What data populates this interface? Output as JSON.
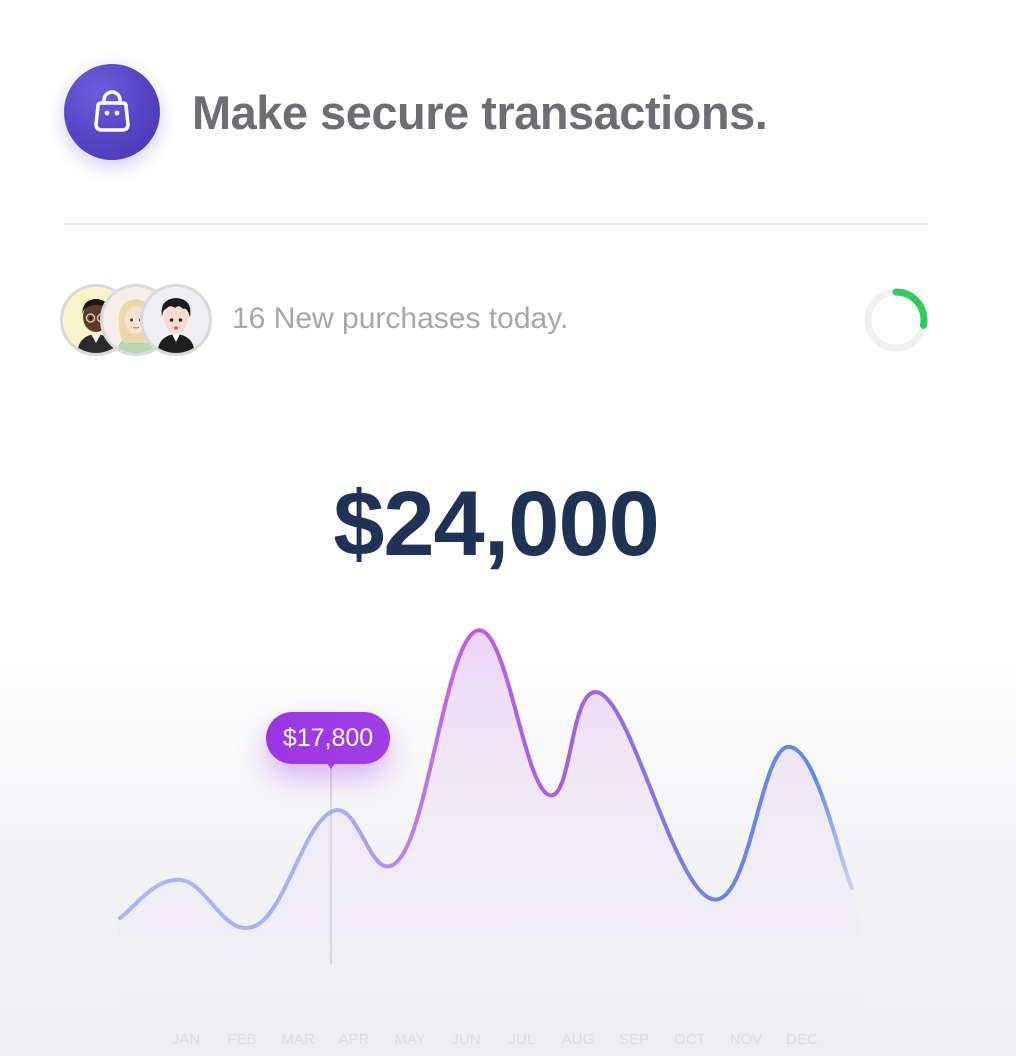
{
  "header": {
    "icon": "shopping-bag-icon",
    "title": "Make secure transactions."
  },
  "purchases": {
    "text": "16 New purchases today.",
    "avatars": [
      "avatar-1",
      "avatar-2",
      "avatar-3"
    ],
    "progress": 0.28,
    "progress_color": "#2ecc59"
  },
  "summary": {
    "total": "$24,000"
  },
  "tooltip": {
    "label": "$17,800",
    "month": "APR",
    "color": "#9b35e4"
  },
  "chart_data": {
    "type": "area",
    "categories": [
      "JAN",
      "FEB",
      "MAR",
      "APR",
      "MAY",
      "JUN",
      "JUL",
      "AUG",
      "SEP",
      "OCT",
      "NOV",
      "DEC"
    ],
    "series": [
      {
        "values": [
          16000,
          14000,
          16500,
          17800,
          15500,
          24000,
          19000,
          21000,
          17000,
          15200,
          19500,
          15500
        ]
      }
    ],
    "highlight_index": 3,
    "line_gradient": [
      "#a7b3f3",
      "#b84de8",
      "#5e87ec"
    ],
    "grid": false
  }
}
